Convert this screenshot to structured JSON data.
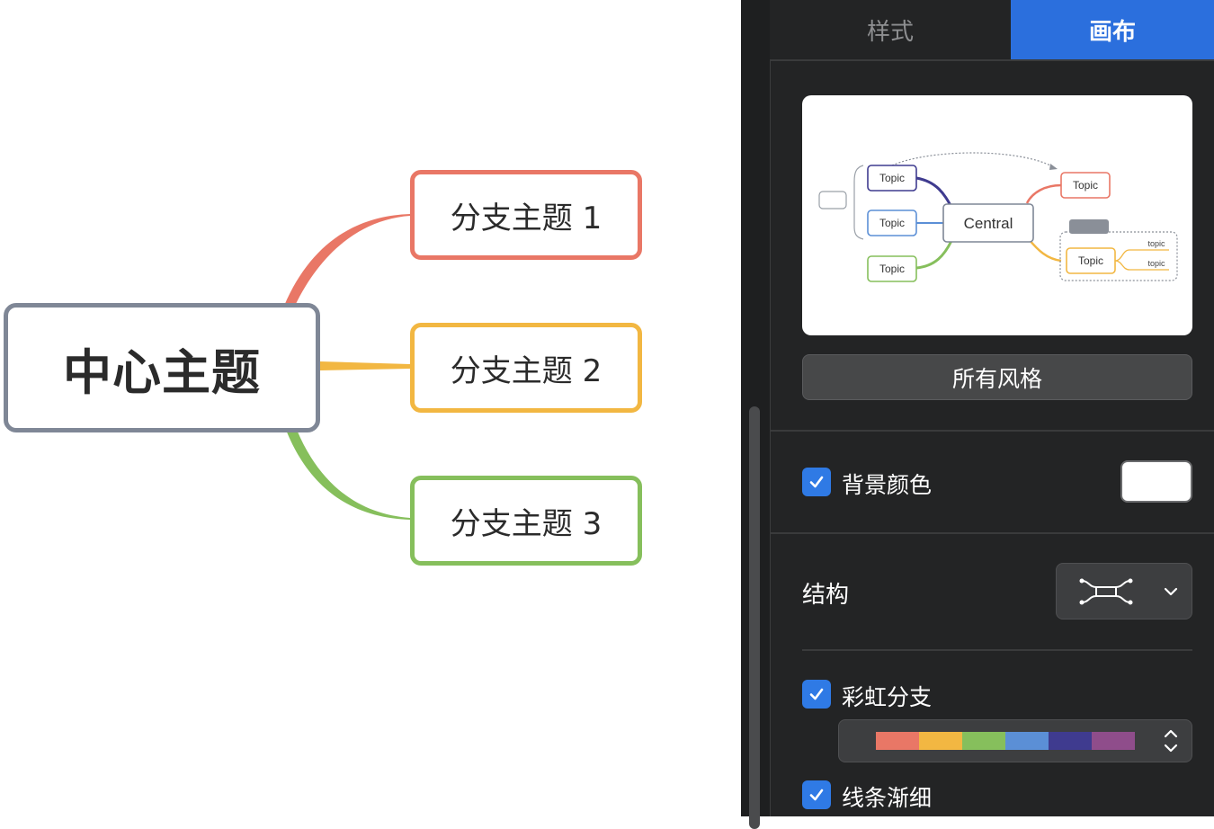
{
  "mindmap": {
    "central_label": "中心主题",
    "branches": [
      {
        "label": "分支主题 1",
        "color": "#e97766"
      },
      {
        "label": "分支主题 2",
        "color": "#f2b742"
      },
      {
        "label": "分支主题 3",
        "color": "#86bf5c"
      }
    ]
  },
  "panel": {
    "tabs": [
      {
        "label": "样式",
        "active": false
      },
      {
        "label": "画布",
        "active": true
      }
    ],
    "preview": {
      "central_label": "Central",
      "topic_label": "Topic",
      "subtopic_label": "topic"
    },
    "all_styles_label": "所有风格",
    "background_color": {
      "label": "背景颜色",
      "checked": true,
      "value": "#ffffff"
    },
    "structure": {
      "label": "结构",
      "icon": "mindmap-structure-icon"
    },
    "rainbow_branch": {
      "label": "彩虹分支",
      "checked": true,
      "colors": [
        "#e97766",
        "#f2b742",
        "#86bf5c",
        "#5b8fd6",
        "#3f3b8f",
        "#8f4d8b"
      ]
    },
    "tapered_lines": {
      "label": "线条渐细",
      "checked": true
    }
  },
  "accent_color": "#2b6fdd"
}
